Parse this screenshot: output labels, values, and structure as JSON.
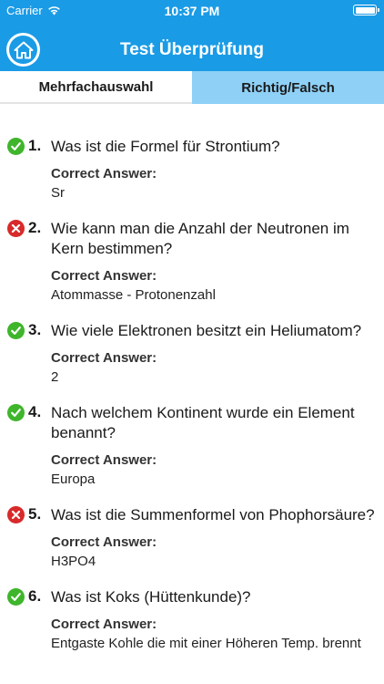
{
  "status_bar": {
    "carrier": "Carrier",
    "time": "10:37 PM"
  },
  "header": {
    "title": "Test Überprüfung",
    "home_icon": "home-icon"
  },
  "tabs": [
    {
      "label": "Mehrfachauswahl",
      "active": true
    },
    {
      "label": "Richtig/Falsch",
      "active": false
    }
  ],
  "answer_label": "Correct Answer:",
  "questions": [
    {
      "number": "1.",
      "text": "Was ist die Formel für Strontium?",
      "answer": "Sr",
      "correct": true
    },
    {
      "number": "2.",
      "text": "Wie kann man die Anzahl der Neutronen im Kern bestimmen?",
      "answer": "Atommasse - Protonenzahl",
      "correct": false
    },
    {
      "number": "3.",
      "text": "Wie viele Elektronen besitzt ein Heliumatom?",
      "answer": "2",
      "correct": true
    },
    {
      "number": "4.",
      "text": "Nach welchem Kontinent wurde ein Element benannt?",
      "answer": "Europa",
      "correct": true
    },
    {
      "number": "5.",
      "text": "Was ist die Summenformel von Phophorsäure?",
      "answer": "H3PO4",
      "correct": false
    },
    {
      "number": "6.",
      "text": "Was ist Koks (Hüttenkunde)?",
      "answer": "Entgaste Kohle die mit einer Höheren Temp. brennt",
      "correct": true
    }
  ],
  "colors": {
    "header": "#1a9be6",
    "tab_inactive": "#8ed0f6",
    "correct": "#3fb52b",
    "wrong": "#d82a2a"
  }
}
